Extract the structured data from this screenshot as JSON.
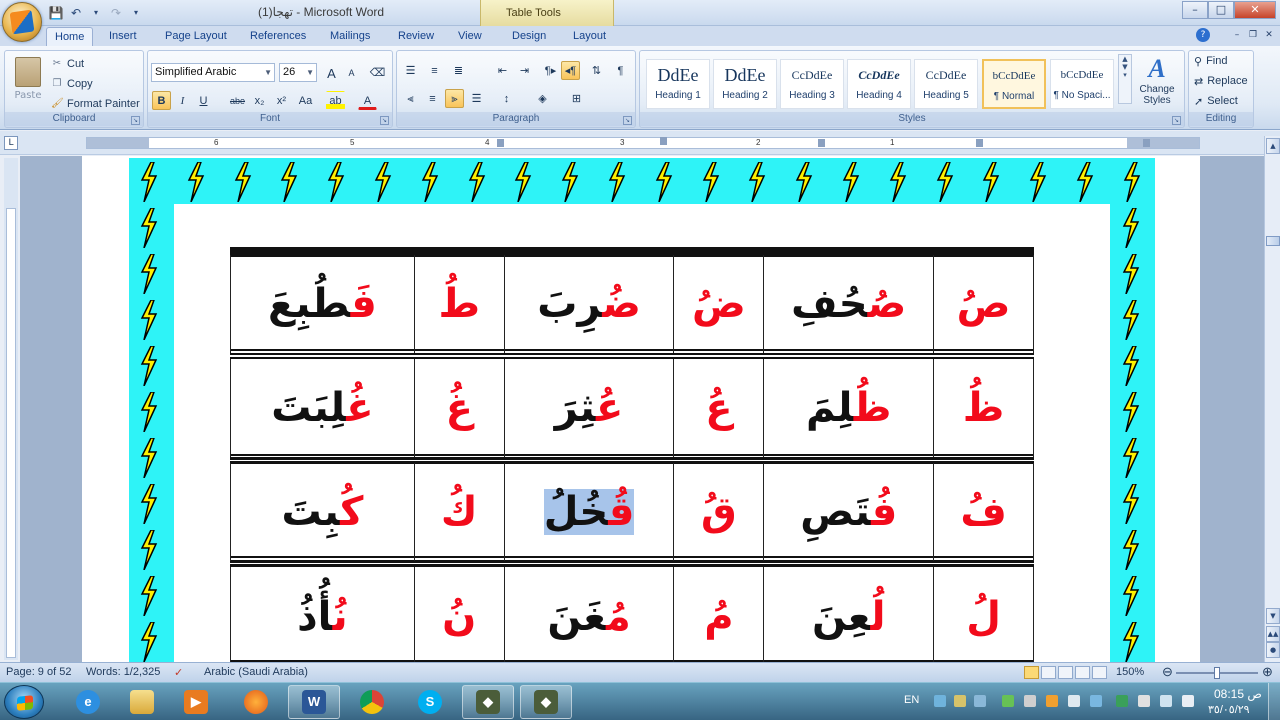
{
  "window": {
    "title": "(1)تهجا - Microsoft Word",
    "context_tab_title": "Table Tools",
    "buttons": {
      "minimize": "–",
      "maximize": "□",
      "close": "✕"
    }
  },
  "tabs": [
    "Home",
    "Insert",
    "Page Layout",
    "References",
    "Mailings",
    "Review",
    "View",
    "Design",
    "Layout"
  ],
  "ribbon": {
    "clipboard": {
      "label": "Clipboard",
      "paste": "Paste",
      "cut": "Cut",
      "copy": "Copy",
      "format_painter": "Format Painter"
    },
    "font": {
      "label": "Font",
      "name": "Simplified Arabic",
      "size": "26",
      "bold": "B",
      "italic": "I",
      "underline": "U",
      "strike": "abe",
      "subscript": "x₂",
      "superscript": "x²",
      "case": "Aa",
      "grow": "A",
      "shrink": "A"
    },
    "paragraph": {
      "label": "Paragraph",
      "pilcrow": "¶"
    },
    "styles": {
      "label": "Styles",
      "items": [
        {
          "sample": "DdEe",
          "name": "Heading 1"
        },
        {
          "sample": "DdEe",
          "name": "Heading 2"
        },
        {
          "sample": "CcDdEe",
          "name": "Heading 3"
        },
        {
          "sample": "CcDdEe",
          "name": "Heading 4"
        },
        {
          "sample": "CcDdEe",
          "name": "Heading 5"
        },
        {
          "sample": "bCcDdEe",
          "name": "¶ Normal"
        },
        {
          "sample": "bCcDdEe",
          "name": "¶ No Spaci..."
        }
      ],
      "change_styles": "Change Styles"
    },
    "editing": {
      "label": "Editing",
      "find": "Find",
      "replace": "Replace",
      "select": "Select"
    }
  },
  "ruler": {
    "numbers": [
      "6",
      "5",
      "4",
      "3",
      "2",
      "1"
    ]
  },
  "table": {
    "rows": [
      [
        {
          "kind": "letter",
          "text": "صُ"
        },
        {
          "kind": "word",
          "red": "صُ",
          "black": "حُفِ"
        },
        {
          "kind": "letter",
          "text": "ضُ"
        },
        {
          "kind": "word",
          "red": "ضُ",
          "black": "رِبَ"
        },
        {
          "kind": "letter",
          "text": "طُ"
        },
        {
          "kind": "word",
          "red": "فَ",
          "black": "طُبِعَ"
        }
      ],
      [
        {
          "kind": "letter",
          "text": "ظُ"
        },
        {
          "kind": "word",
          "red": "ظُ",
          "black": "لِمَ"
        },
        {
          "kind": "letter",
          "text": "عُ"
        },
        {
          "kind": "word",
          "red": "عُ",
          "black": "ثِرَ"
        },
        {
          "kind": "letter",
          "text": "غُ"
        },
        {
          "kind": "word",
          "red": "غُ",
          "black": "لِبَتَ"
        }
      ],
      [
        {
          "kind": "letter",
          "text": "فُ"
        },
        {
          "kind": "word",
          "red": "فُ",
          "black": "تَصِ"
        },
        {
          "kind": "letter",
          "text": "قُ"
        },
        {
          "kind": "word",
          "red": "قُ",
          "black": "خُلُ"
        },
        {
          "kind": "letter",
          "text": "كُ"
        },
        {
          "kind": "word",
          "red": "كُ",
          "black": "بِتَ"
        }
      ],
      [
        {
          "kind": "letter",
          "text": "لُ"
        },
        {
          "kind": "word",
          "red": "لُ",
          "black": "عِنَ"
        },
        {
          "kind": "letter",
          "text": "مُ"
        },
        {
          "kind": "word",
          "red": "مُ",
          "black": "غَنَ"
        },
        {
          "kind": "letter",
          "text": "نُ"
        },
        {
          "kind": "word",
          "red": "نُ",
          "black": "أُذُ"
        }
      ]
    ]
  },
  "status": {
    "page": "Page: 9 of 52",
    "words": "Words: 1/2,325",
    "language": "Arabic (Saudi Arabia)",
    "zoom": "150%"
  },
  "taskbar": {
    "lang": "EN",
    "time": "ص 08:15",
    "date": "٣٥/٠٥/٢٩",
    "apps": [
      "internet-explorer",
      "file-explorer",
      "media-player",
      "firefox",
      "word",
      "chrome",
      "skype",
      "app-1",
      "app-2"
    ]
  },
  "colors": {
    "border_cyan": "#2ef3f7",
    "bolt_yellow": "#fff000",
    "letter_red": "#f20b1b",
    "selection": "#a7c4ea"
  }
}
